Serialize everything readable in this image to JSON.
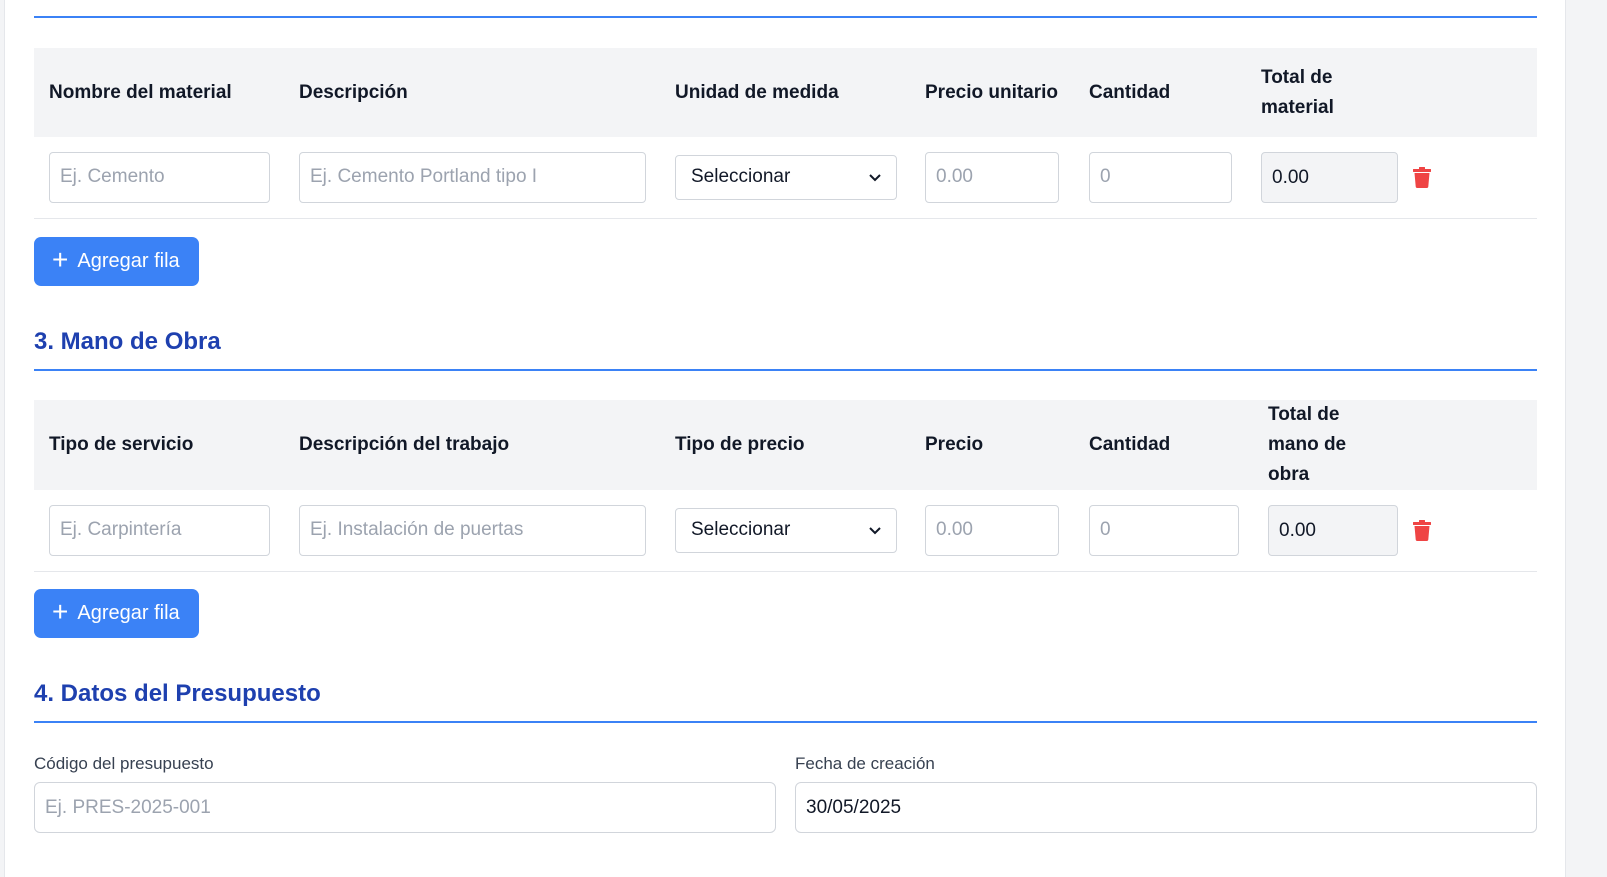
{
  "materials": {
    "headers": [
      "Nombre del material",
      "Descripción",
      "Unidad de medida",
      "Precio unitario",
      "Cantidad",
      "Total de material"
    ],
    "row": {
      "name_placeholder": "Ej. Cemento",
      "description_placeholder": "Ej. Cemento Portland tipo I",
      "unit_selected": "Seleccionar",
      "price_placeholder": "0.00",
      "quantity_placeholder": "0",
      "total_value": "0.00"
    },
    "add_button_label": "Agregar fila"
  },
  "labor": {
    "title": "3. Mano de Obra",
    "headers": [
      "Tipo de servicio",
      "Descripción del trabajo",
      "Tipo de precio",
      "Precio",
      "Cantidad",
      "Total de mano de obra"
    ],
    "row": {
      "service_placeholder": "Ej. Carpintería",
      "description_placeholder": "Ej. Instalación de puertas",
      "price_type_selected": "Seleccionar",
      "price_placeholder": "0.00",
      "quantity_placeholder": "0",
      "total_value": "0.00"
    },
    "add_button_label": "Agregar fila"
  },
  "budget": {
    "title": "4. Datos del Presupuesto",
    "code_label": "Código del presupuesto",
    "code_placeholder": "Ej. PRES-2025-001",
    "date_label": "Fecha de creación",
    "date_value": "30/05/2025"
  },
  "colors": {
    "accent": "#3b82f6",
    "section_title": "#1e40af",
    "delete": "#ef4444",
    "table_header_bg": "#f3f4f6"
  },
  "icons": {
    "delete": "trash-icon",
    "add": "plus-icon",
    "select": "chevron-down-icon"
  }
}
